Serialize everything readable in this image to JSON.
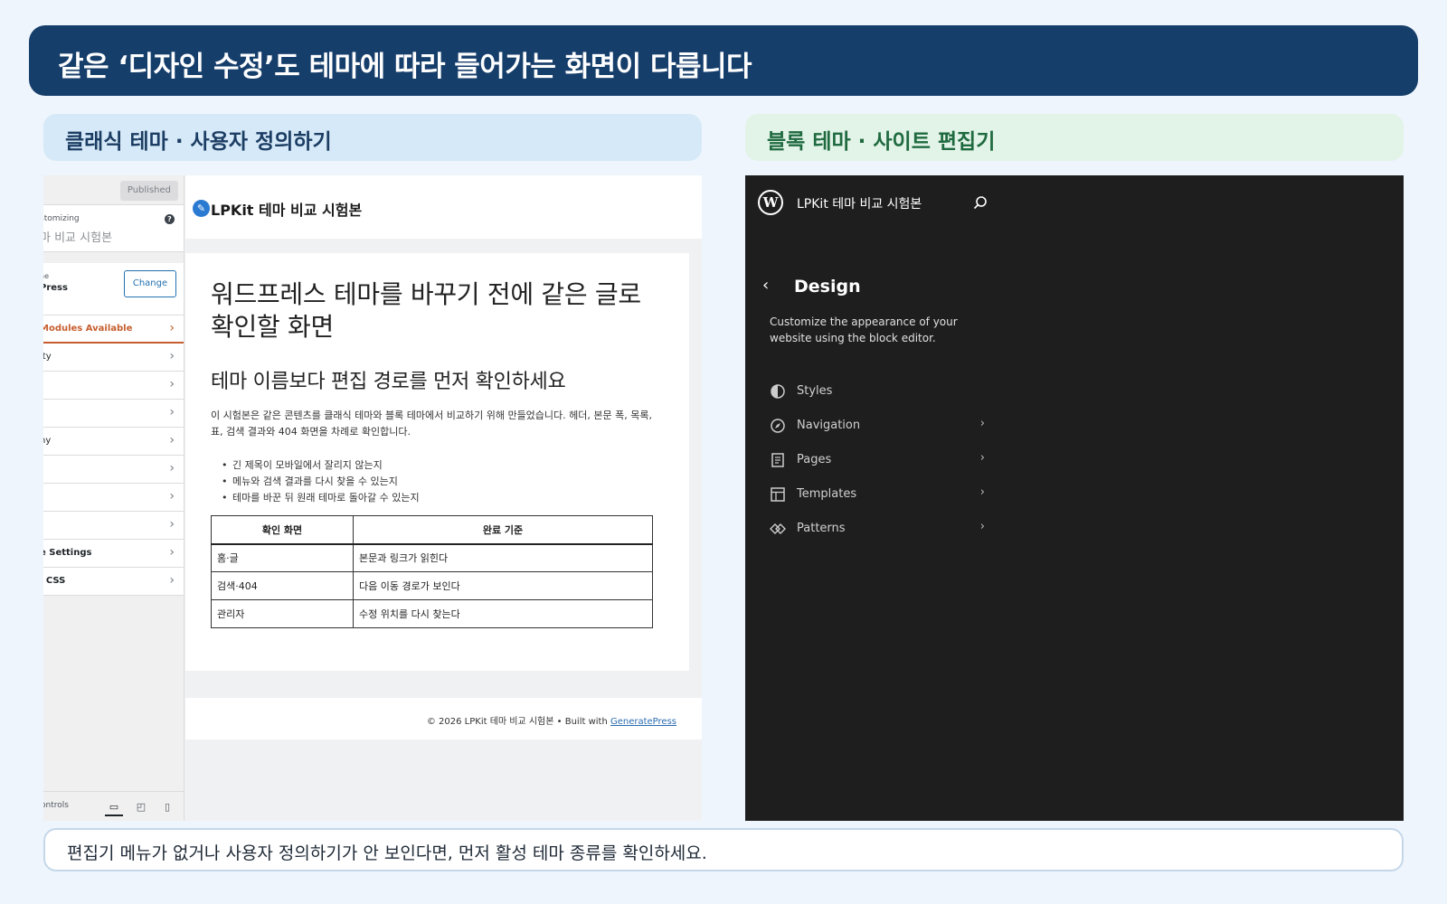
{
  "banner": {
    "title": "같은 ‘디자인 수정’도 테마에 따라 들어가는 화면이 다릅니다"
  },
  "left_panel": {
    "heading": "클래식 테마 · 사용자 정의하기"
  },
  "right_panel": {
    "heading": "블록 테마 · 사이트 편집기"
  },
  "customizer": {
    "published_label": "Published",
    "customizing_label": "stomizing",
    "site_title": "마 비교 시험본",
    "theme_label": "ne",
    "theme_name": "Press",
    "change_label": "Change",
    "menu": [
      {
        "label": "Modules Available"
      },
      {
        "label": "ity"
      },
      {
        "label": ""
      },
      {
        "label": ""
      },
      {
        "label": "hy"
      },
      {
        "label": ""
      },
      {
        "label": ""
      },
      {
        "label": ""
      },
      {
        "label": "e Settings"
      },
      {
        "label": "l CSS"
      }
    ],
    "footer_label": "ontrols",
    "icons": {
      "desktop": "desktop-icon",
      "tablet": "tablet-icon",
      "mobile": "mobile-icon",
      "help": "help-icon",
      "chevron": "chevron-right-icon"
    }
  },
  "preview": {
    "site_name": "LPKit 테마 비교 시험본",
    "post_title": "워드프레스 테마를 바꾸기 전에 같은 글로 확인할 화면",
    "subtitle": "테마 이름보다 편집 경로를 먼저 확인하세요",
    "body": "이 시험본은 같은 콘텐츠를 클래식 테마와 블록 테마에서 비교하기 위해 만들었습니다. 헤더, 본문 폭, 목록, 표, 검색 결과와 404 화면을 차례로 확인합니다.",
    "bullets": [
      "긴 제목이 모바일에서 잘리지 않는지",
      "메뉴와 검색 결과를 다시 찾을 수 있는지",
      "테마를 바꾼 뒤 원래 테마로 돌아갈 수 있는지"
    ],
    "table": {
      "headers": [
        "확인 화면",
        "완료 기준"
      ],
      "rows": [
        [
          "홈·글",
          "본문과 링크가 읽힌다"
        ],
        [
          "검색·404",
          "다음 이동 경로가 보인다"
        ],
        [
          "관리자",
          "수정 위치를 다시 찾는다"
        ]
      ]
    },
    "footer_text": "© 2026 LPKit 테마 비교 시험본 • Built with ",
    "footer_link": "GeneratePress"
  },
  "site_editor": {
    "site_name": "LPKit 테마 비교 시험본",
    "title": "Design",
    "description": "Customize the appearance of your website using the block editor.",
    "nav": [
      {
        "label": "Styles",
        "icon": "styles-icon",
        "has_chevron": false
      },
      {
        "label": "Navigation",
        "icon": "navigation-icon",
        "has_chevron": true
      },
      {
        "label": "Pages",
        "icon": "pages-icon",
        "has_chevron": true
      },
      {
        "label": "Templates",
        "icon": "templates-icon",
        "has_chevron": true
      },
      {
        "label": "Patterns",
        "icon": "patterns-icon",
        "has_chevron": true
      }
    ]
  },
  "note": {
    "text": "편집기 메뉴가 없거나 사용자 정의하기가 안 보인다면, 먼저 활성 테마 종류를 확인하세요."
  },
  "colors": {
    "banner": "#163e6b",
    "left_head_bg": "#d6e9f8",
    "right_head_bg": "#e2f3e8",
    "editor_bg": "#1e1e1e",
    "accent_orange": "#c65d2e"
  }
}
